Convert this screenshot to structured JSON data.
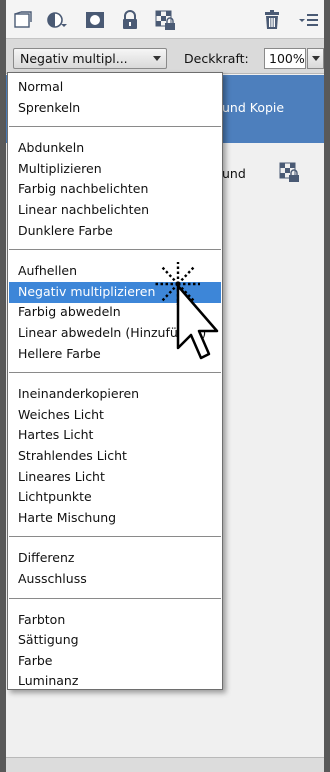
{
  "toolbar": {
    "icons": [
      "new-layer-icon",
      "adjustment-layer-icon",
      "layer-mask-icon",
      "lock-icon",
      "lock-transparency-icon",
      "trash-icon",
      "panel-menu-icon"
    ]
  },
  "options": {
    "blend_mode_value": "Negativ multipl...",
    "opacity_label": "Deckkraft:",
    "opacity_value": "100%"
  },
  "layers": {
    "selected_label_fragment": "und Kopie",
    "second_label_fragment": "und"
  },
  "menu": {
    "groups": [
      [
        "Normal",
        "Sprenkeln"
      ],
      [
        "Abdunkeln",
        "Multiplizieren",
        "Farbig nachbelichten",
        "Linear nachbelichten",
        "Dunklere Farbe"
      ],
      [
        "Aufhellen",
        "Negativ multiplizieren",
        "Farbig abwedeln",
        "Linear abwedeln (Hinzufügen)",
        "Hellere Farbe"
      ],
      [
        "Ineinanderkopieren",
        "Weiches Licht",
        "Hartes Licht",
        "Strahlendes Licht",
        "Lineares Licht",
        "Lichtpunkte",
        "Harte Mischung"
      ],
      [
        "Differenz",
        "Ausschluss"
      ],
      [
        "Farbton",
        "Sättigung",
        "Farbe",
        "Luminanz"
      ]
    ],
    "highlighted": "Negativ multiplizieren"
  },
  "colors": {
    "highlight": "#3d86d8",
    "selected_layer": "#4d7fbd",
    "frame": "#595959"
  }
}
